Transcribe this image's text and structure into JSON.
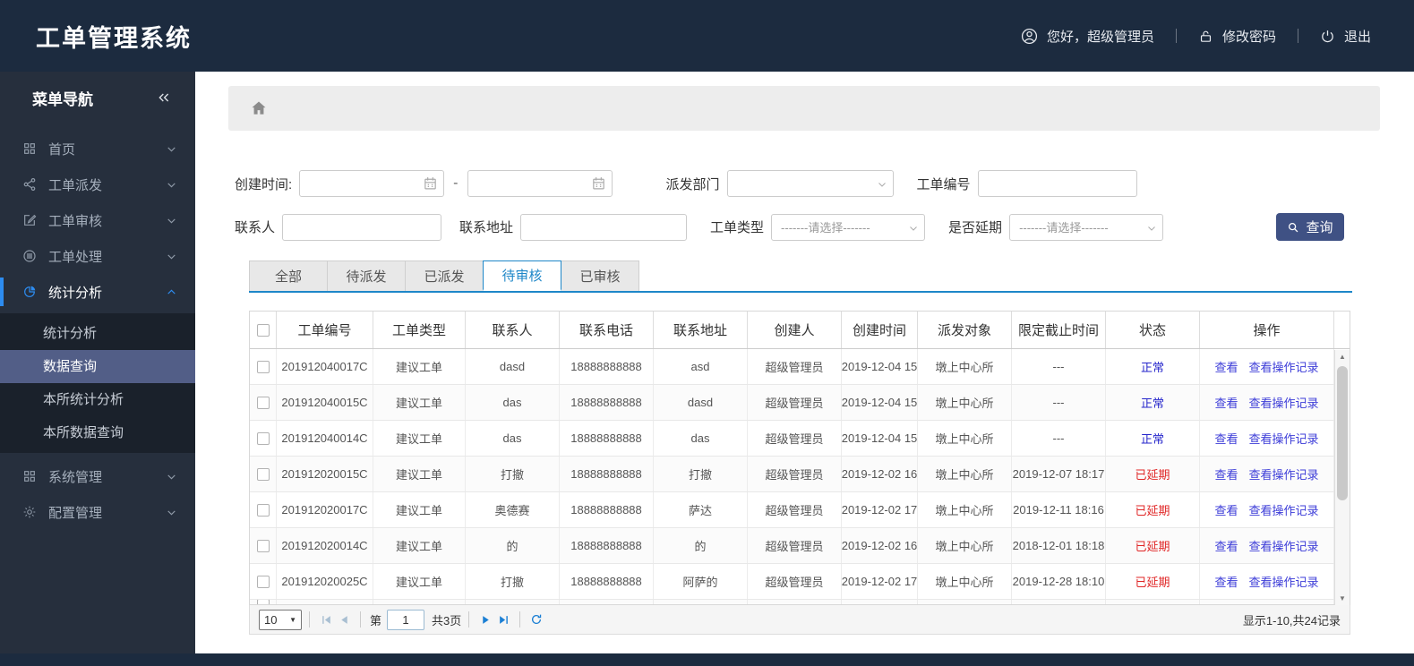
{
  "app_title": "工单管理系统",
  "header": {
    "greeting": "您好，超级管理员",
    "change_password": "修改密码",
    "logout": "退出"
  },
  "sidebar": {
    "title": "菜单导航",
    "collapse_glyph": "«",
    "items": [
      {
        "label": "首页"
      },
      {
        "label": "工单派发"
      },
      {
        "label": "工单审核"
      },
      {
        "label": "工单处理"
      },
      {
        "label": "统计分析"
      },
      {
        "label": "系统管理"
      },
      {
        "label": "配置管理"
      }
    ],
    "submenu": [
      "统计分析",
      "数据查询",
      "本所统计分析",
      "本所数据查询"
    ]
  },
  "filters": {
    "create_time_label": "创建时间:",
    "range_separator": "-",
    "depart_label": "派发部门",
    "order_no_label": "工单编号",
    "contact_label": "联系人",
    "address_label": "联系地址",
    "type_label": "工单类型",
    "delay_label": "是否延期",
    "select_placeholder": "-------请选择-------",
    "search_button": "查询"
  },
  "tabs": [
    "全部",
    "待派发",
    "已派发",
    "待审核",
    "已审核"
  ],
  "table": {
    "columns": [
      "工单编号",
      "工单类型",
      "联系人",
      "联系电话",
      "联系地址",
      "创建人",
      "创建时间",
      "派发对象",
      "限定截止时间",
      "状态",
      "操作"
    ],
    "action_view": "查看",
    "action_log": "查看操作记录",
    "rows": [
      {
        "id": "201912040017C",
        "type": "建议工单",
        "contact": "dasd",
        "phone": "18888888888",
        "address": "asd",
        "creator": "超级管理员",
        "created": "2019-12-04 15",
        "target": "墩上中心所",
        "deadline": "---",
        "status": "正常",
        "status_type": "normal"
      },
      {
        "id": "201912040015C",
        "type": "建议工单",
        "contact": "das",
        "phone": "18888888888",
        "address": "dasd",
        "creator": "超级管理员",
        "created": "2019-12-04 15",
        "target": "墩上中心所",
        "deadline": "---",
        "status": "正常",
        "status_type": "normal"
      },
      {
        "id": "201912040014C",
        "type": "建议工单",
        "contact": "das",
        "phone": "18888888888",
        "address": "das",
        "creator": "超级管理员",
        "created": "2019-12-04 15",
        "target": "墩上中心所",
        "deadline": "---",
        "status": "正常",
        "status_type": "normal"
      },
      {
        "id": "201912020015C",
        "type": "建议工单",
        "contact": "打撤",
        "phone": "18888888888",
        "address": "打撤",
        "creator": "超级管理员",
        "created": "2019-12-02 16",
        "target": "墩上中心所",
        "deadline": "2019-12-07 18:17",
        "status": "已延期",
        "status_type": "delayed"
      },
      {
        "id": "201912020017C",
        "type": "建议工单",
        "contact": "奥德赛",
        "phone": "18888888888",
        "address": "萨达",
        "creator": "超级管理员",
        "created": "2019-12-02 17",
        "target": "墩上中心所",
        "deadline": "2019-12-11 18:16",
        "status": "已延期",
        "status_type": "delayed"
      },
      {
        "id": "201912020014C",
        "type": "建议工单",
        "contact": "的",
        "phone": "18888888888",
        "address": "的",
        "creator": "超级管理员",
        "created": "2019-12-02 16",
        "target": "墩上中心所",
        "deadline": "2018-12-01 18:18",
        "status": "已延期",
        "status_type": "delayed"
      },
      {
        "id": "201912020025C",
        "type": "建议工单",
        "contact": "打撤",
        "phone": "18888888888",
        "address": "阿萨的",
        "creator": "超级管理员",
        "created": "2019-12-02 17",
        "target": "墩上中心所",
        "deadline": "2019-12-28 18:10",
        "status": "已延期",
        "status_type": "delayed"
      }
    ]
  },
  "pagination": {
    "page_size": "10",
    "page_prefix": "第",
    "page_value": "1",
    "total_pages": "共3页",
    "summary": "显示1-10,共24记录"
  },
  "colors": {
    "status_normal": "#2525cb",
    "status_delayed": "#e02626",
    "link": "#3c3cd8",
    "accent": "#2d8cf0",
    "tab_blue": "#1e87c8",
    "button": "#3f5184",
    "navy": "#1c2b3f"
  }
}
